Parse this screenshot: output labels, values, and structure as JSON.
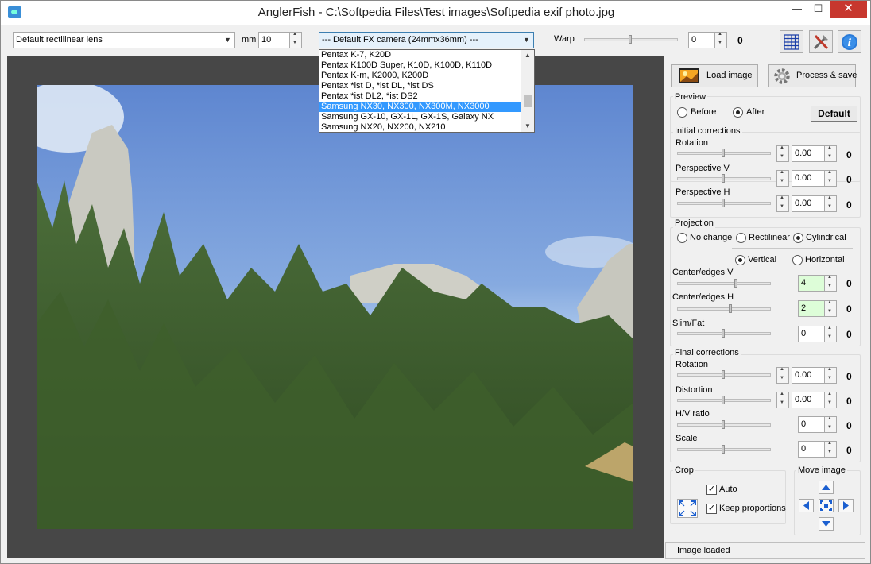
{
  "window": {
    "title": "AnglerFish - C:\\Softpedia Files\\Test images\\Softpedia exif photo.jpg",
    "minimize": "—",
    "maximize": "☐",
    "close": "✕"
  },
  "toolbar": {
    "lens": "Default rectilinear lens",
    "mm_label": "mm",
    "mm_value": "10",
    "camera": "--- Default FX camera (24mmx36mm) ---",
    "warp_label": "Warp",
    "warp_value": "0",
    "warp_display": "0"
  },
  "camera_list": [
    "Pentax K-7, K20D",
    "Pentax K100D Super, K10D, K100D, K110D",
    "Pentax K-m, K2000, K200D",
    "Pentax *ist D, *ist DL, *ist DS",
    "Pentax *ist DL2, *ist DS2",
    "Samsung NX30, NX300, NX300M, NX3000",
    "Samsung GX-10, GX-1L, GX-1S, Galaxy NX",
    "Samsung NX20, NX200, NX210"
  ],
  "camera_list_selected": 5,
  "panel": {
    "load_image": "Load image",
    "process_save": "Process & save",
    "preview": {
      "title": "Preview",
      "before": "Before",
      "after": "After",
      "default": "Default"
    },
    "initial": {
      "title": "Initial corrections",
      "rotation": {
        "label": "Rotation",
        "value": "0.00",
        "display": "0"
      },
      "persp_v": {
        "label": "Perspective V",
        "value": "0.00",
        "display": "0"
      },
      "persp_h": {
        "label": "Perspective H",
        "value": "0.00",
        "display": "0"
      }
    },
    "projection": {
      "title": "Projection",
      "no_change": "No change",
      "rectilinear": "Rectilinear",
      "cylindrical": "Cylindrical",
      "vertical": "Vertical",
      "horizontal": "Horizontal",
      "center_v": {
        "label": "Center/edges V",
        "value": "4",
        "display": "0"
      },
      "center_h": {
        "label": "Center/edges H",
        "value": "2",
        "display": "0"
      },
      "slim": {
        "label": "Slim/Fat",
        "value": "0",
        "display": "0"
      }
    },
    "final": {
      "title": "Final corrections",
      "rotation": {
        "label": "Rotation",
        "value": "0.00",
        "display": "0"
      },
      "distortion": {
        "label": "Distortion",
        "value": "0.00",
        "display": "0"
      },
      "hv_ratio": {
        "label": "H/V ratio",
        "value": "0",
        "display": "0"
      },
      "scale": {
        "label": "Scale",
        "value": "0",
        "display": "0"
      }
    },
    "crop": {
      "title": "Crop",
      "auto": "Auto",
      "keep": "Keep proportions"
    },
    "move": {
      "title": "Move image"
    }
  },
  "status": "Image loaded",
  "colors": {
    "accent": "#3399ff",
    "close": "#c7372e",
    "green_field": "#ddfdd8"
  }
}
